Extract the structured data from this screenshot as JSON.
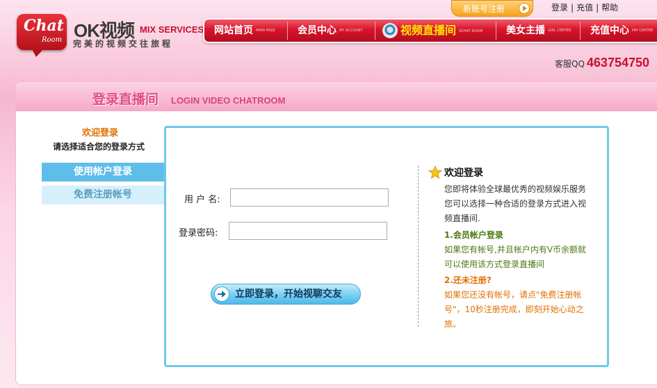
{
  "header": {
    "logo_chat": "Chat",
    "logo_room": "Room",
    "brand_name": "OK视频",
    "brand_en": "MIX SERVICES",
    "slogan": "完美的视频交往旅程",
    "register_pill": "新账号注册",
    "top_links": [
      "登录",
      "充值",
      "帮助"
    ],
    "nav": [
      {
        "label": "网站首页",
        "sub": "MAIN PAGE"
      },
      {
        "label": "会员中心",
        "sub": "MY ACCOUNT"
      },
      {
        "label": "视频直播间",
        "sub": "VCHAT ROOM"
      },
      {
        "label": "美女主播",
        "sub": "GIRL CENTER"
      },
      {
        "label": "充值中心",
        "sub": "PAY CENTER"
      }
    ],
    "qq_label": "客服QQ",
    "qq_number": "463754750"
  },
  "panel": {
    "title_cn": "登录直播间",
    "title_en": "LOGIN VIDEO CHATROOM",
    "welcome": "欢迎登录",
    "choose": "请选择适合您的登录方式",
    "tabs": [
      "使用帐户登录",
      "免费注册帐号"
    ],
    "form": {
      "username_label": "用 户 名:",
      "password_label": "登录密码:",
      "username_value": "",
      "password_value": "",
      "submit": "立即登录，开始视聊交友"
    },
    "info": {
      "title": "欢迎登录",
      "body": "您即将体验全球最优秀的视频娱乐服务 您可以选择一种合适的登录方式进入视频直播间.",
      "s1_head": "1.会员帐户登录",
      "s1_body": "如果您有帐号,并且帐户内有V币余额就可以使用该方式登录直播间",
      "s2_head": "2.还未注册?",
      "s2_body": "如果您还没有帐号，请点\"免费注册帐号\"，10秒注册完成，即刻开始心动之旅。"
    }
  },
  "colors": {
    "brand_red": "#c8102e",
    "accent_blue": "#5fbde9",
    "title_pink": "#e24a86",
    "green_text": "#4a7a12",
    "orange_text": "#e07000"
  }
}
